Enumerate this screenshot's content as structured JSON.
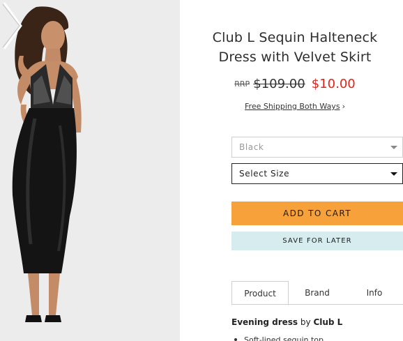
{
  "product": {
    "title_line1": "Club L Sequin Halteneck",
    "title_line2": "Dress with Velvet Skirt",
    "rrp_label": "RRP",
    "old_price": "$109.00",
    "new_price": "$10.00",
    "shipping_text": "Free Shipping Both Ways",
    "shipping_chevron": "›"
  },
  "options": {
    "colour_value": "Black",
    "size_placeholder": "Select Size"
  },
  "actions": {
    "add_to_cart": "ADD TO CART",
    "save_for_later": "SAVE FOR LATER"
  },
  "tabs": [
    {
      "label": "Product",
      "active": true
    },
    {
      "label": "Brand",
      "active": false
    },
    {
      "label": "Info",
      "active": false
    }
  ],
  "description": {
    "type": "Evening dress",
    "by": "by",
    "brand": "Club L",
    "bullet1": "Soft-lined sequin top"
  },
  "gallery": {
    "next_icon": "chevron-right-icon",
    "image_subject": "model wearing black sequin halteneck velvet dress"
  },
  "colors": {
    "accent_orange": "#f7a13a",
    "save_bg": "#d6ecee",
    "sale_red": "#e0251b"
  }
}
